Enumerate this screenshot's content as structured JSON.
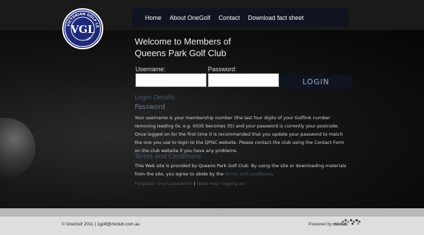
{
  "logo": {
    "ring_text_top": "VICTORIAN GOLF LEAGUE",
    "ring_text_bottom": "INC.",
    "monogram": "VGL",
    "colors": {
      "fill": "#1e2a78",
      "ring": "#ffffff"
    }
  },
  "nav": {
    "items": [
      {
        "label": "Home"
      },
      {
        "label": "About OneGolf"
      },
      {
        "label": "Contact"
      },
      {
        "label": "Download fact sheet"
      }
    ]
  },
  "welcome": {
    "line1": "Welcome to Members of",
    "line2": "Queens Park Golf Club"
  },
  "login": {
    "username_label": "Username:",
    "username_value": "",
    "password_label": "Password:",
    "password_value": "",
    "button_label": "LOGIN"
  },
  "sections": {
    "login_details": "Login Details",
    "password_heading": "Password",
    "password_text": "Your username is your membership number (the last four digits of your Golflink number removing leading 0s, e.g. 0035 becomes 35) and your password is currently your postcode. Once logged on for the first time it is recommended that you update your password to match the one you use to login to the QPGC website. Please contact the club using the Contact Form on the club website if you have any problems.",
    "terms_heading": "Terms and Conditions",
    "terms_text": "This Web site is provided by Queens Park Golf Club. By using the site or downloading materials from the site, you agree to abide by the",
    "terms_link": "terms and conditions",
    "terms_end": ".",
    "forgot_link": "Forgotten your password?",
    "separator": " | ",
    "help_link": "Need help logging on?"
  },
  "footer": {
    "copyright": "© OneGolf 2011 | 1golf@miclub.com.au",
    "powered_by": "Powered by",
    "brand": "miclub",
    "icon": "miclub-checker-icon"
  }
}
